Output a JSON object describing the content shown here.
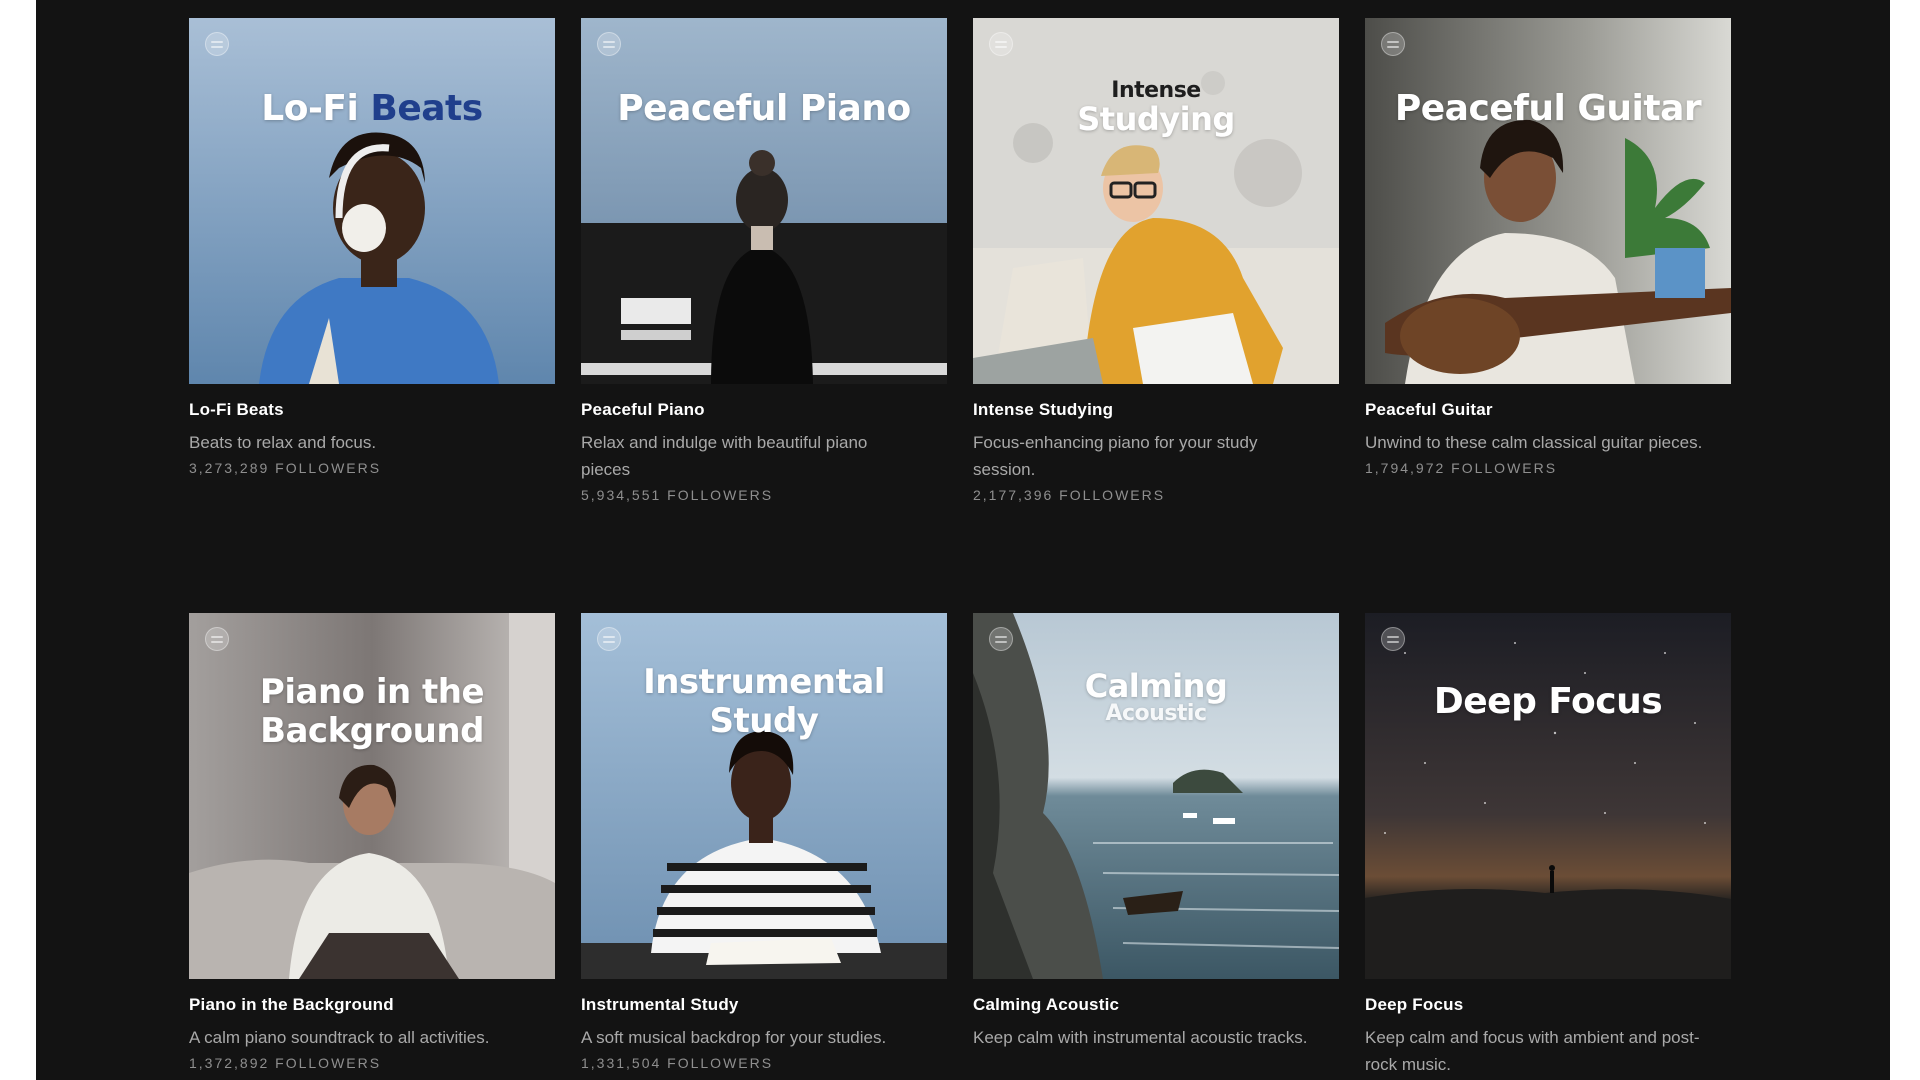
{
  "playlists": [
    {
      "cover_title": "Lo-Fi",
      "cover_title_accent": "Beats",
      "name": "Lo-Fi Beats",
      "description": "Beats to relax and focus.",
      "followers": "3,273,289 FOLLOWERS"
    },
    {
      "cover_title": "Peaceful Piano",
      "name": "Peaceful Piano",
      "description": "Relax and indulge with beautiful piano pieces",
      "followers": "5,934,551 FOLLOWERS"
    },
    {
      "cover_title_line1": "Intense",
      "cover_title_line2": "Studying",
      "name": "Intense Studying",
      "description": "Focus-enhancing piano for your study session.",
      "followers": "2,177,396 FOLLOWERS"
    },
    {
      "cover_title": "Peaceful Guitar",
      "name": "Peaceful Guitar",
      "description": "Unwind to these calm classical guitar pieces.",
      "followers": "1,794,972 FOLLOWERS"
    },
    {
      "cover_title_line1": "Piano in the",
      "cover_title_line2": "Background",
      "name": "Piano in the Background",
      "description": "A calm piano soundtrack to all activities.",
      "followers": "1,372,892 FOLLOWERS"
    },
    {
      "cover_title_line1": "Instrumental",
      "cover_title_line2": "Study",
      "name": "Instrumental Study",
      "description": "A soft musical backdrop for your studies.",
      "followers": "1,331,504 FOLLOWERS"
    },
    {
      "cover_title": "Calming",
      "cover_subtitle": "Acoustic",
      "name": "Calming Acoustic",
      "description": "Keep calm with instrumental acoustic tracks."
    },
    {
      "cover_title": "Deep Focus",
      "name": "Deep Focus",
      "description": "Keep calm and focus with ambient and post-rock music."
    }
  ],
  "colors": {
    "background": "#131313",
    "title": "#ffffff",
    "description": "#a9a9a9",
    "accent_blue": "#203f8c"
  }
}
